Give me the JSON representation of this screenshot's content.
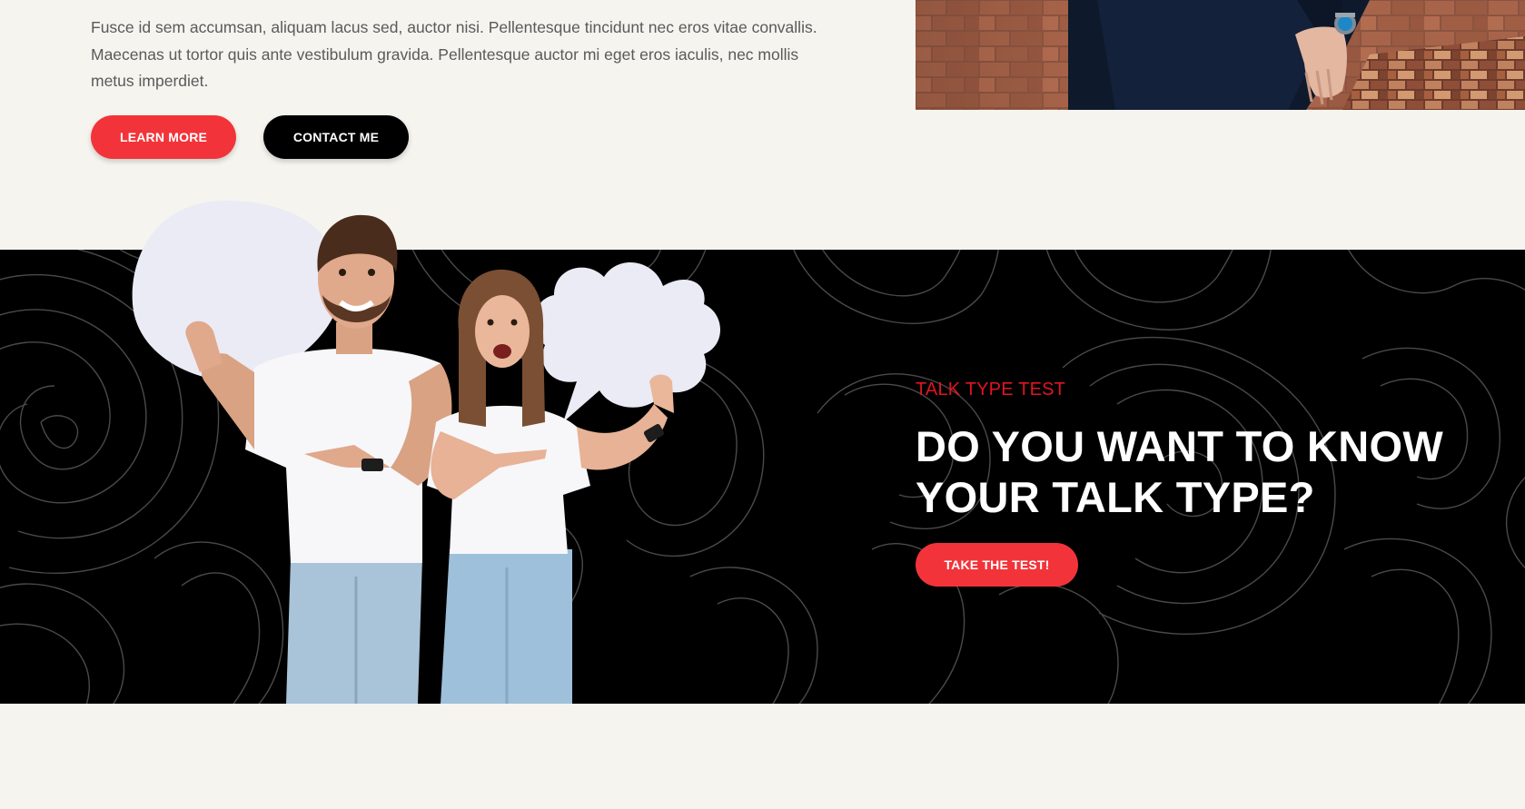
{
  "intro": {
    "paragraph_line_1": "Fusce id sem accumsan, aliquam lacus sed, auctor nisi. Pellentesque tincidunt nec eros vitae convallis.",
    "paragraph_line_2": "Maecenas ut tortor quis ante vestibulum gravida. Pellentesque auctor mi eget eros iaculis, nec mollis",
    "paragraph_line_3": "metus imperdiet.",
    "learn_more_label": "LEARN MORE",
    "contact_label": "CONTACT ME"
  },
  "talk_type": {
    "eyebrow": "TALK TYPE TEST",
    "headline_line_1": "DO YOU WANT TO KNOW",
    "headline_line_2": "YOUR TALK TYPE?",
    "cta_label": "TAKE THE TEST!"
  },
  "colors": {
    "page_background": "#f6f4ef",
    "accent_red": "#f2343a",
    "eyebrow_red": "#e3141f",
    "band_background": "#000000",
    "text_gray": "#5a5a5a"
  }
}
